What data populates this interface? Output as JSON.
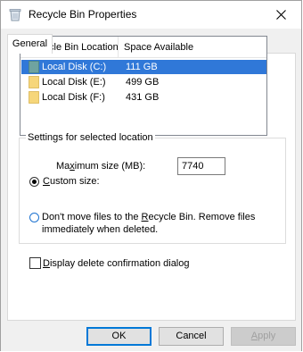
{
  "window": {
    "title": "Recycle Bin Properties"
  },
  "tabs": [
    {
      "label": "General"
    }
  ],
  "list": {
    "columns": [
      "Recycle Bin Location",
      "Space Available"
    ],
    "rows": [
      {
        "name": "Local Disk (C:)",
        "space": "111 GB",
        "selected": true
      },
      {
        "name": "Local Disk (E:)",
        "space": "499 GB",
        "selected": false
      },
      {
        "name": "Local Disk (F:)",
        "space": "431 GB",
        "selected": false
      }
    ]
  },
  "settings": {
    "group_title": "Settings for selected location",
    "custom_size_label_accel": "C",
    "custom_size_label_rest": "ustom size:",
    "max_size_label_pre": "Ma",
    "max_size_label_accel": "x",
    "max_size_label_post": "imum size (MB):",
    "max_size_value": "7740",
    "dont_move_label_pre": "Don't move files to the ",
    "dont_move_label_accel": "R",
    "dont_move_label_post": "ecycle Bin. Remove files",
    "dont_move_label_line2": "immediately when deleted.",
    "confirm_label_accel": "D",
    "confirm_label_rest": "isplay delete confirmation dialog"
  },
  "buttons": {
    "ok": "OK",
    "cancel": "Cancel",
    "apply_accel": "A",
    "apply_rest": "pply"
  },
  "colors": {
    "selection": "#3078d8",
    "folder": "#f6d67a",
    "focus_blue": "#0078d7"
  }
}
